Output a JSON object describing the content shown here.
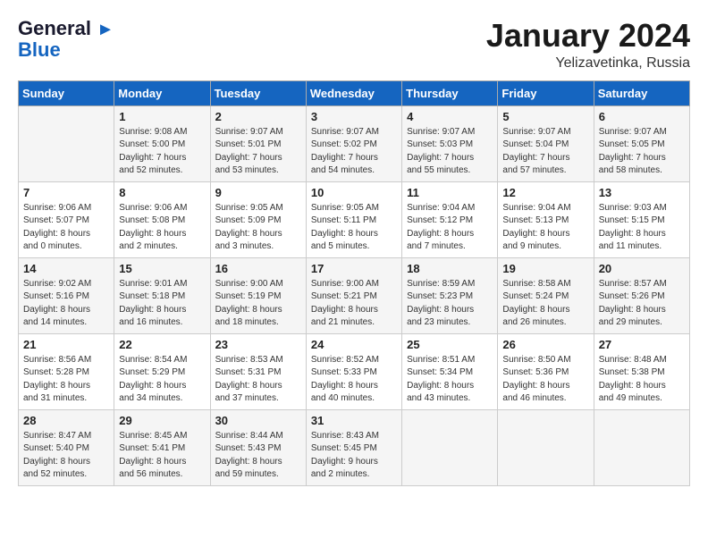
{
  "logo": {
    "line1": "General",
    "line2": "Blue"
  },
  "calendar": {
    "title": "January 2024",
    "subtitle": "Yelizavetinka, Russia"
  },
  "headers": [
    "Sunday",
    "Monday",
    "Tuesday",
    "Wednesday",
    "Thursday",
    "Friday",
    "Saturday"
  ],
  "weeks": [
    [
      {
        "day": "",
        "info": ""
      },
      {
        "day": "1",
        "info": "Sunrise: 9:08 AM\nSunset: 5:00 PM\nDaylight: 7 hours\nand 52 minutes."
      },
      {
        "day": "2",
        "info": "Sunrise: 9:07 AM\nSunset: 5:01 PM\nDaylight: 7 hours\nand 53 minutes."
      },
      {
        "day": "3",
        "info": "Sunrise: 9:07 AM\nSunset: 5:02 PM\nDaylight: 7 hours\nand 54 minutes."
      },
      {
        "day": "4",
        "info": "Sunrise: 9:07 AM\nSunset: 5:03 PM\nDaylight: 7 hours\nand 55 minutes."
      },
      {
        "day": "5",
        "info": "Sunrise: 9:07 AM\nSunset: 5:04 PM\nDaylight: 7 hours\nand 57 minutes."
      },
      {
        "day": "6",
        "info": "Sunrise: 9:07 AM\nSunset: 5:05 PM\nDaylight: 7 hours\nand 58 minutes."
      }
    ],
    [
      {
        "day": "7",
        "info": "Sunrise: 9:06 AM\nSunset: 5:07 PM\nDaylight: 8 hours\nand 0 minutes."
      },
      {
        "day": "8",
        "info": "Sunrise: 9:06 AM\nSunset: 5:08 PM\nDaylight: 8 hours\nand 2 minutes."
      },
      {
        "day": "9",
        "info": "Sunrise: 9:05 AM\nSunset: 5:09 PM\nDaylight: 8 hours\nand 3 minutes."
      },
      {
        "day": "10",
        "info": "Sunrise: 9:05 AM\nSunset: 5:11 PM\nDaylight: 8 hours\nand 5 minutes."
      },
      {
        "day": "11",
        "info": "Sunrise: 9:04 AM\nSunset: 5:12 PM\nDaylight: 8 hours\nand 7 minutes."
      },
      {
        "day": "12",
        "info": "Sunrise: 9:04 AM\nSunset: 5:13 PM\nDaylight: 8 hours\nand 9 minutes."
      },
      {
        "day": "13",
        "info": "Sunrise: 9:03 AM\nSunset: 5:15 PM\nDaylight: 8 hours\nand 11 minutes."
      }
    ],
    [
      {
        "day": "14",
        "info": "Sunrise: 9:02 AM\nSunset: 5:16 PM\nDaylight: 8 hours\nand 14 minutes."
      },
      {
        "day": "15",
        "info": "Sunrise: 9:01 AM\nSunset: 5:18 PM\nDaylight: 8 hours\nand 16 minutes."
      },
      {
        "day": "16",
        "info": "Sunrise: 9:00 AM\nSunset: 5:19 PM\nDaylight: 8 hours\nand 18 minutes."
      },
      {
        "day": "17",
        "info": "Sunrise: 9:00 AM\nSunset: 5:21 PM\nDaylight: 8 hours\nand 21 minutes."
      },
      {
        "day": "18",
        "info": "Sunrise: 8:59 AM\nSunset: 5:23 PM\nDaylight: 8 hours\nand 23 minutes."
      },
      {
        "day": "19",
        "info": "Sunrise: 8:58 AM\nSunset: 5:24 PM\nDaylight: 8 hours\nand 26 minutes."
      },
      {
        "day": "20",
        "info": "Sunrise: 8:57 AM\nSunset: 5:26 PM\nDaylight: 8 hours\nand 29 minutes."
      }
    ],
    [
      {
        "day": "21",
        "info": "Sunrise: 8:56 AM\nSunset: 5:28 PM\nDaylight: 8 hours\nand 31 minutes."
      },
      {
        "day": "22",
        "info": "Sunrise: 8:54 AM\nSunset: 5:29 PM\nDaylight: 8 hours\nand 34 minutes."
      },
      {
        "day": "23",
        "info": "Sunrise: 8:53 AM\nSunset: 5:31 PM\nDaylight: 8 hours\nand 37 minutes."
      },
      {
        "day": "24",
        "info": "Sunrise: 8:52 AM\nSunset: 5:33 PM\nDaylight: 8 hours\nand 40 minutes."
      },
      {
        "day": "25",
        "info": "Sunrise: 8:51 AM\nSunset: 5:34 PM\nDaylight: 8 hours\nand 43 minutes."
      },
      {
        "day": "26",
        "info": "Sunrise: 8:50 AM\nSunset: 5:36 PM\nDaylight: 8 hours\nand 46 minutes."
      },
      {
        "day": "27",
        "info": "Sunrise: 8:48 AM\nSunset: 5:38 PM\nDaylight: 8 hours\nand 49 minutes."
      }
    ],
    [
      {
        "day": "28",
        "info": "Sunrise: 8:47 AM\nSunset: 5:40 PM\nDaylight: 8 hours\nand 52 minutes."
      },
      {
        "day": "29",
        "info": "Sunrise: 8:45 AM\nSunset: 5:41 PM\nDaylight: 8 hours\nand 56 minutes."
      },
      {
        "day": "30",
        "info": "Sunrise: 8:44 AM\nSunset: 5:43 PM\nDaylight: 8 hours\nand 59 minutes."
      },
      {
        "day": "31",
        "info": "Sunrise: 8:43 AM\nSunset: 5:45 PM\nDaylight: 9 hours\nand 2 minutes."
      },
      {
        "day": "",
        "info": ""
      },
      {
        "day": "",
        "info": ""
      },
      {
        "day": "",
        "info": ""
      }
    ]
  ]
}
